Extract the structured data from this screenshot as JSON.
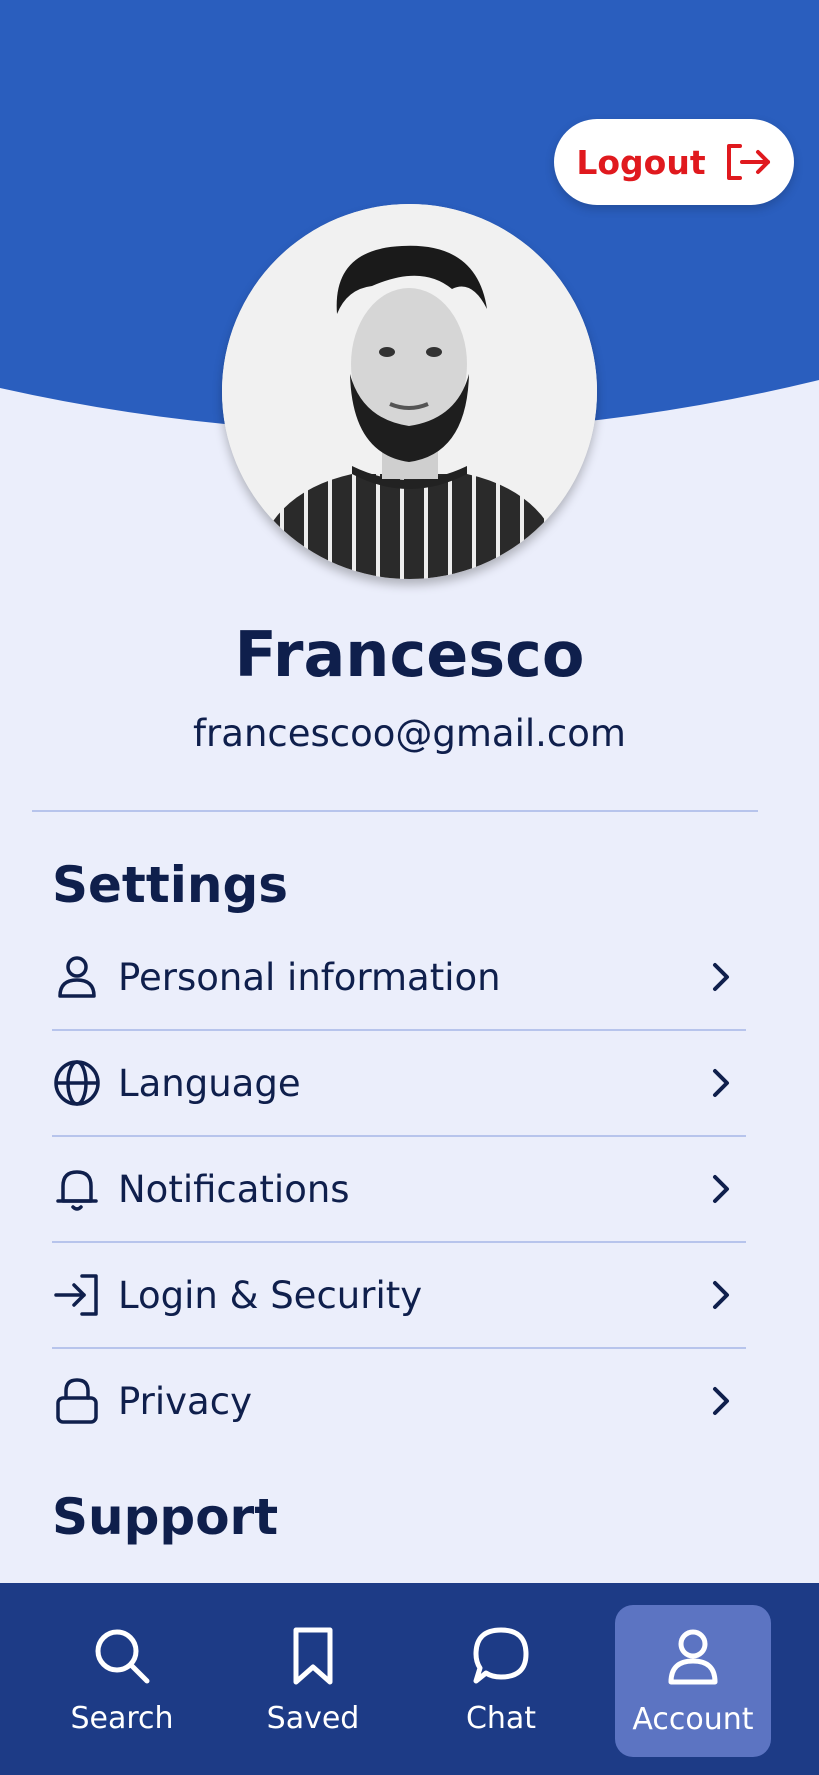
{
  "header": {
    "logout_label": "Logout",
    "colors": {
      "header_blue": "#2A5EBE",
      "logout_red": "#E0191E",
      "page_bg": "#EBEEFB",
      "nav_bg": "#1D3B86",
      "nav_active": "#5C74C2"
    }
  },
  "profile": {
    "name": "Francesco",
    "email": "francescoo@gmail.com",
    "avatar_icon": "profile-photo"
  },
  "settings": {
    "title": "Settings",
    "items": [
      {
        "label": "Personal information",
        "icon": "person-icon"
      },
      {
        "label": "Language",
        "icon": "globe-icon"
      },
      {
        "label": "Notifications",
        "icon": "bell-icon"
      },
      {
        "label": "Login & Security",
        "icon": "login-icon"
      },
      {
        "label": "Privacy",
        "icon": "lock-icon"
      }
    ]
  },
  "support": {
    "title": "Support"
  },
  "nav": {
    "items": [
      {
        "label": "Search",
        "icon": "search-icon"
      },
      {
        "label": "Saved",
        "icon": "bookmark-icon"
      },
      {
        "label": "Chat",
        "icon": "chat-icon"
      },
      {
        "label": "Account",
        "icon": "person-icon",
        "active": true
      }
    ]
  }
}
